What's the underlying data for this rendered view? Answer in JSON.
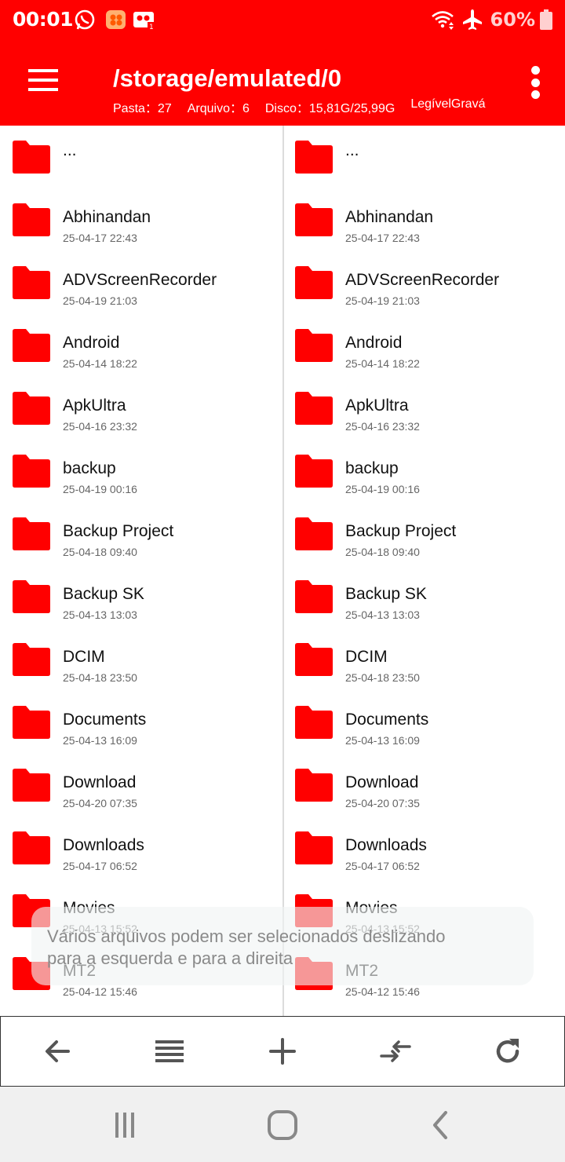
{
  "status_bar": {
    "time": "00:01",
    "battery": "60%",
    "icons": [
      "whatsapp-icon",
      "app-icon",
      "recording-icon",
      "wifi-icon",
      "airplane-icon",
      "battery-icon"
    ]
  },
  "app_bar": {
    "path": "/storage/emulated/0",
    "info": {
      "folders": "Pasta：27",
      "files": "Arquivo：6",
      "disk": "Disco：15,81G/25,99G",
      "mode": "LegívelGravá"
    }
  },
  "colors": {
    "accent": "#ff0000",
    "folder": "#ff0000",
    "toolbar_icon": "#555555"
  },
  "panes": {
    "left": {
      "parent": "...",
      "items": [
        {
          "name": "Abhinandan",
          "date": "25-04-17 22:43"
        },
        {
          "name": "ADVScreenRecorder",
          "date": "25-04-19 21:03"
        },
        {
          "name": "Android",
          "date": "25-04-14 18:22"
        },
        {
          "name": "ApkUltra",
          "date": "25-04-16 23:32"
        },
        {
          "name": "backup",
          "date": "25-04-19 00:16"
        },
        {
          "name": "Backup Project",
          "date": "25-04-18 09:40"
        },
        {
          "name": "Backup SK",
          "date": "25-04-13 13:03"
        },
        {
          "name": "DCIM",
          "date": "25-04-18 23:50"
        },
        {
          "name": "Documents",
          "date": "25-04-13 16:09"
        },
        {
          "name": "Download",
          "date": "25-04-20 07:35"
        },
        {
          "name": "Downloads",
          "date": "25-04-17 06:52"
        },
        {
          "name": "Movies",
          "date": "25-04-13 15:52"
        },
        {
          "name": "MT2",
          "date": "25-04-12 15:46"
        }
      ]
    },
    "right": {
      "parent": "...",
      "items": [
        {
          "name": "Abhinandan",
          "date": "25-04-17 22:43"
        },
        {
          "name": "ADVScreenRecorder",
          "date": "25-04-19 21:03"
        },
        {
          "name": "Android",
          "date": "25-04-14 18:22"
        },
        {
          "name": "ApkUltra",
          "date": "25-04-16 23:32"
        },
        {
          "name": "backup",
          "date": "25-04-19 00:16"
        },
        {
          "name": "Backup Project",
          "date": "25-04-18 09:40"
        },
        {
          "name": "Backup SK",
          "date": "25-04-13 13:03"
        },
        {
          "name": "DCIM",
          "date": "25-04-18 23:50"
        },
        {
          "name": "Documents",
          "date": "25-04-13 16:09"
        },
        {
          "name": "Download",
          "date": "25-04-20 07:35"
        },
        {
          "name": "Downloads",
          "date": "25-04-17 06:52"
        },
        {
          "name": "Movies",
          "date": "25-04-13 15:52"
        },
        {
          "name": "MT2",
          "date": "25-04-12 15:46"
        }
      ]
    }
  },
  "toast": {
    "line1": "Vários arquivos podem ser selecionados deslizando",
    "line2": "para a esquerda e para a direita"
  },
  "toolbar": {
    "buttons": [
      "back-arrow-icon",
      "list-icon",
      "plus-icon",
      "swap-icon",
      "refresh-icon"
    ]
  },
  "system_nav": {
    "buttons": [
      "recents-icon",
      "home-icon",
      "back-icon"
    ]
  }
}
